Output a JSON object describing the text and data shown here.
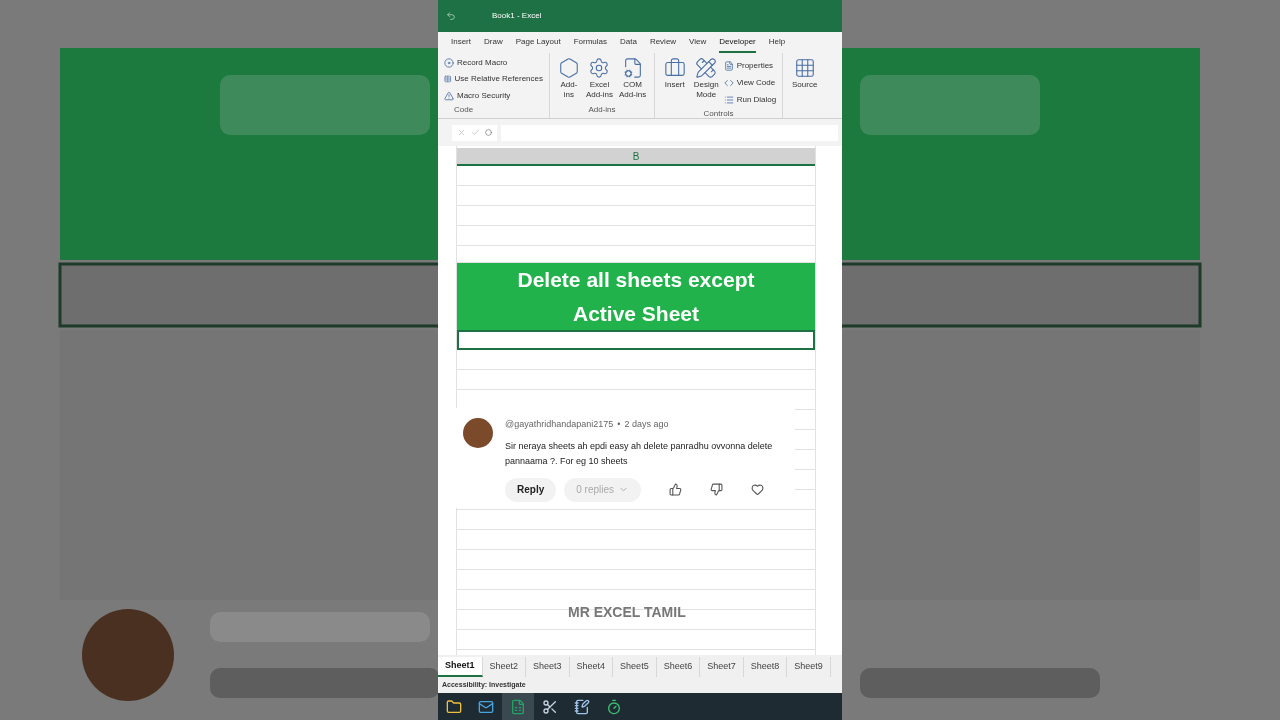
{
  "window": {
    "title": "Book1 - Excel"
  },
  "ribbon_tabs": [
    {
      "label": "Insert",
      "selected": false
    },
    {
      "label": "Draw",
      "selected": false
    },
    {
      "label": "Page Layout",
      "selected": false
    },
    {
      "label": "Formulas",
      "selected": false
    },
    {
      "label": "Data",
      "selected": false
    },
    {
      "label": "Review",
      "selected": false
    },
    {
      "label": "View",
      "selected": false
    },
    {
      "label": "Developer",
      "selected": true
    },
    {
      "label": "Help",
      "selected": false
    }
  ],
  "ribbon": {
    "code": {
      "items": [
        "Record Macro",
        "Use Relative References",
        "Macro Security"
      ],
      "label": "Code"
    },
    "addins": {
      "items": [
        "Add-\nins",
        "Excel\nAdd-ins",
        "COM\nAdd-ins"
      ],
      "label": "Add-ins"
    },
    "controls": {
      "large": [
        "Insert",
        "Design\nMode"
      ],
      "small": [
        "Properties",
        "View Code",
        "Run Dialog"
      ],
      "label": "Controls"
    },
    "xml": {
      "large": "Source"
    }
  },
  "column_header": "B",
  "banner": "Delete all sheets except\nActive Sheet",
  "comment": {
    "author": "@gayathridhandapani2175",
    "separator": "•",
    "time": "2 days ago",
    "text": "Sir neraya sheets ah epdi easy ah delete panradhu ovvonna delete pannaama ?. For eg 10 sheets",
    "reply": "Reply",
    "replies": "0 replies"
  },
  "channel_label": "MR EXCEL TAMIL",
  "sheet_tabs": [
    {
      "label": "Sheet1",
      "selected": true
    },
    {
      "label": "Sheet2",
      "selected": false
    },
    {
      "label": "Sheet3",
      "selected": false
    },
    {
      "label": "Sheet4",
      "selected": false
    },
    {
      "label": "Sheet5",
      "selected": false
    },
    {
      "label": "Sheet6",
      "selected": false
    },
    {
      "label": "Sheet7",
      "selected": false
    },
    {
      "label": "Sheet8",
      "selected": false
    },
    {
      "label": "Sheet9",
      "selected": false
    }
  ],
  "status_bar": "Accessibility: Investigate",
  "taskbar": [
    {
      "kind": "folder",
      "selected": false
    },
    {
      "kind": "outlook",
      "selected": false
    },
    {
      "kind": "excel",
      "selected": true
    },
    {
      "kind": "snip",
      "selected": false
    },
    {
      "kind": "notepad",
      "selected": false
    },
    {
      "kind": "timer",
      "selected": false
    }
  ]
}
